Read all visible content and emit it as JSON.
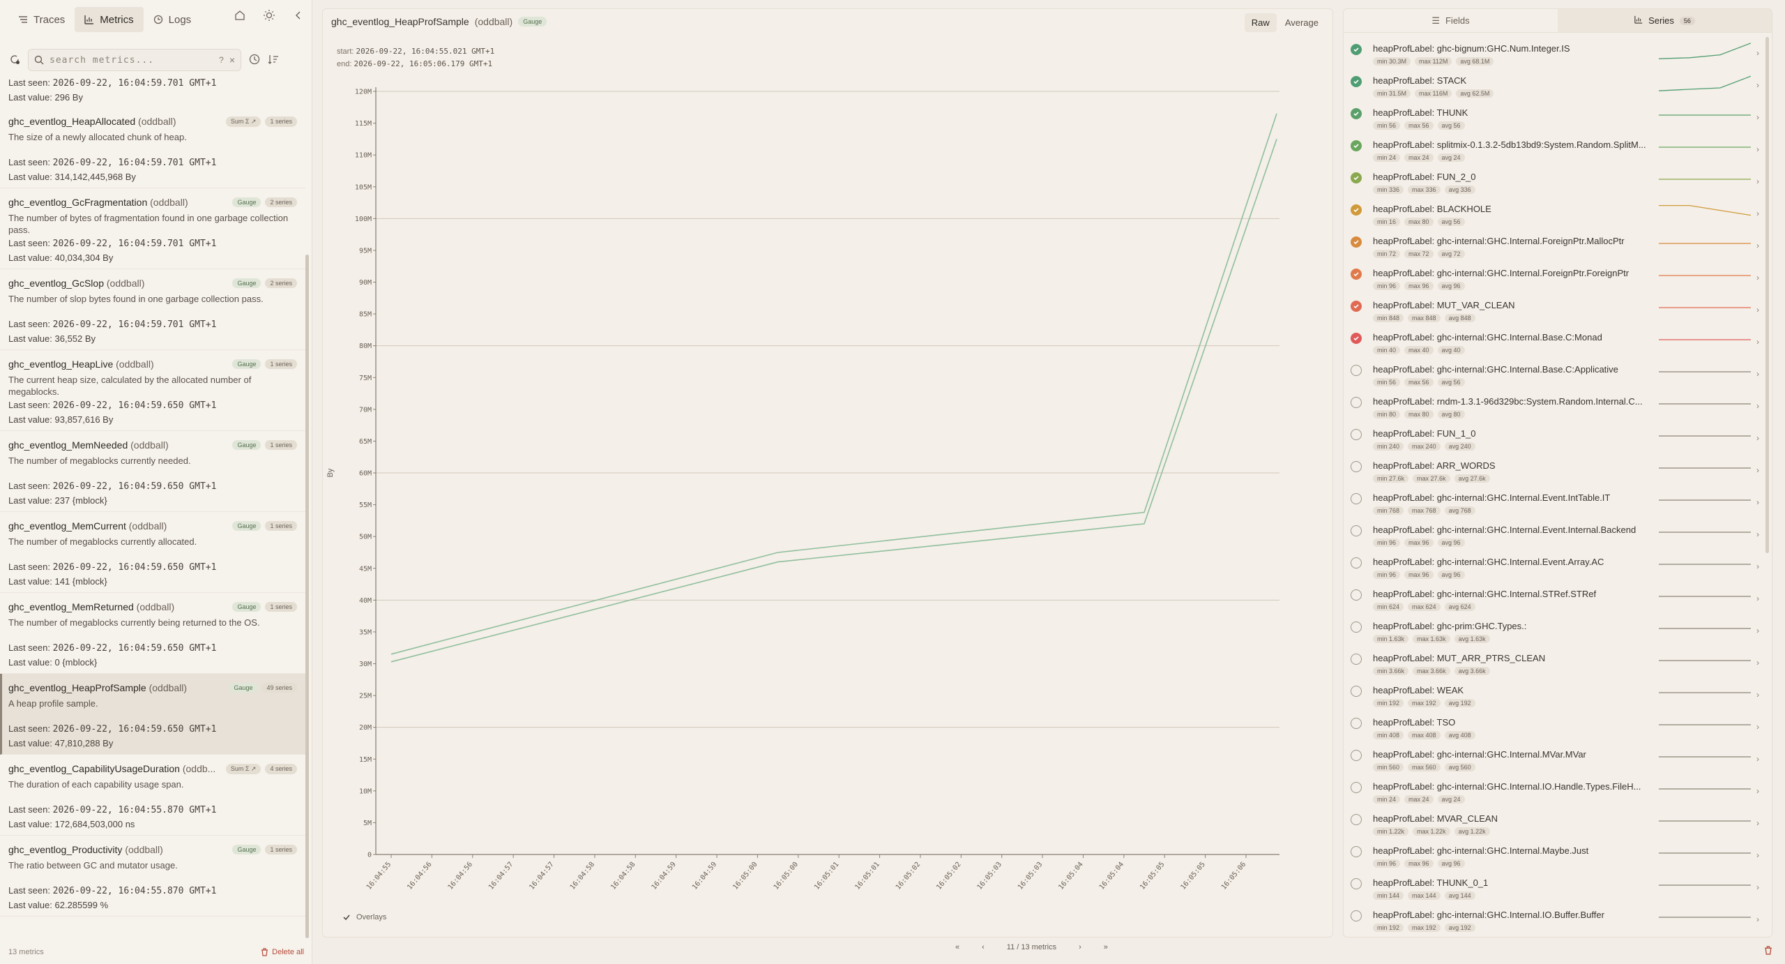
{
  "nav": {
    "tabs": [
      {
        "label": "Traces",
        "icon": "traces-icon"
      },
      {
        "label": "Metrics",
        "icon": "metrics-icon"
      },
      {
        "label": "Logs",
        "icon": "logs-icon"
      }
    ]
  },
  "search": {
    "placeholder": "search metrics...",
    "help": "?"
  },
  "partial_item": {
    "last_seen_label": "Last seen:",
    "last_seen": "2026-09-22, 16:04:59.701 GMT+1",
    "last_value_label": "Last value:",
    "last_value": "296 By"
  },
  "metrics": [
    {
      "name": "ghc_eventlog_HeapAllocated",
      "source": "(oddball)",
      "type": "Sum Σ ↗",
      "type_style": "gray",
      "series": "1 series",
      "desc": "The size of a newly allocated chunk of heap.",
      "last_seen": "2026-09-22, 16:04:59.701 GMT+1",
      "last_value": "314,142,445,968 By"
    },
    {
      "name": "ghc_eventlog_GcFragmentation",
      "source": "(oddball)",
      "type": "Gauge",
      "type_style": "green",
      "series": "2 series",
      "desc": "The number of bytes of fragmentation found in one garbage collection pass.",
      "last_seen": "2026-09-22, 16:04:59.701 GMT+1",
      "last_value": "40,034,304 By"
    },
    {
      "name": "ghc_eventlog_GcSlop",
      "source": "(oddball)",
      "type": "Gauge",
      "type_style": "green",
      "series": "2 series",
      "desc": "The number of slop bytes found in one garbage collection pass.",
      "last_seen": "2026-09-22, 16:04:59.701 GMT+1",
      "last_value": "36,552 By"
    },
    {
      "name": "ghc_eventlog_HeapLive",
      "source": "(oddball)",
      "type": "Gauge",
      "type_style": "green",
      "series": "1 series",
      "desc": "The current heap size, calculated by the allocated number of megablocks.",
      "last_seen": "2026-09-22, 16:04:59.650 GMT+1",
      "last_value": "93,857,616 By"
    },
    {
      "name": "ghc_eventlog_MemNeeded",
      "source": "(oddball)",
      "type": "Gauge",
      "type_style": "green",
      "series": "1 series",
      "desc": "The number of megablocks currently needed.",
      "last_seen": "2026-09-22, 16:04:59.650 GMT+1",
      "last_value": "237 {mblock}"
    },
    {
      "name": "ghc_eventlog_MemCurrent",
      "source": "(oddball)",
      "type": "Gauge",
      "type_style": "green",
      "series": "1 series",
      "desc": "The number of megablocks currently allocated.",
      "last_seen": "2026-09-22, 16:04:59.650 GMT+1",
      "last_value": "141 {mblock}"
    },
    {
      "name": "ghc_eventlog_MemReturned",
      "source": "(oddball)",
      "type": "Gauge",
      "type_style": "green",
      "series": "1 series",
      "desc": "The number of megablocks currently being returned to the OS.",
      "last_seen": "2026-09-22, 16:04:59.650 GMT+1",
      "last_value": "0 {mblock}"
    },
    {
      "name": "ghc_eventlog_HeapProfSample",
      "source": "(oddball)",
      "type": "Gauge",
      "type_style": "green",
      "series": "49 series",
      "desc": "A heap profile sample.",
      "last_seen": "2026-09-22, 16:04:59.650 GMT+1",
      "last_value": "47,810,288 By",
      "selected": true
    },
    {
      "name": "ghc_eventlog_CapabilityUsageDuration",
      "source": "(oddb...",
      "type": "Sum Σ ↗",
      "type_style": "gray",
      "series": "4 series",
      "desc": "The duration of each capability usage span.",
      "last_seen": "2026-09-22, 16:04:55.870 GMT+1",
      "last_value": "172,684,503,000 ns"
    },
    {
      "name": "ghc_eventlog_Productivity",
      "source": "(oddball)",
      "type": "Gauge",
      "type_style": "green",
      "series": "1 series",
      "desc": "The ratio between GC and mutator usage.",
      "last_seen": "2026-09-22, 16:04:55.870 GMT+1",
      "last_value": "62.285599 %"
    }
  ],
  "labels": {
    "last_seen": "Last seen:",
    "last_value": "Last value:"
  },
  "left_footer": {
    "count": "13 metrics",
    "delete_all": "Delete all"
  },
  "center": {
    "title": "ghc_eventlog_HeapProfSample",
    "source": "(oddball)",
    "type": "Gauge",
    "modes": [
      "Raw",
      "Average"
    ],
    "start_label": "start:",
    "start": "2026-09-22, 16:04:55.021 GMT+1",
    "end_label": "end:",
    "end": "2026-09-22, 16:05:06.179 GMT+1",
    "overlays": "Overlays"
  },
  "chart_data": {
    "type": "line",
    "ylabel": "By",
    "y_ticks": [
      "0",
      "5M",
      "10M",
      "15M",
      "20M",
      "25M",
      "30M",
      "35M",
      "40M",
      "45M",
      "50M",
      "55M",
      "60M",
      "65M",
      "70M",
      "75M",
      "80M",
      "85M",
      "90M",
      "95M",
      "100M",
      "105M",
      "110M",
      "115M",
      "120M"
    ],
    "ylim": [
      0,
      120
    ],
    "y_unit": "M",
    "x_ticks": [
      "16:04:55",
      "16:04:56",
      "16:04:56",
      "16:04:57",
      "16:04:57",
      "16:04:58",
      "16:04:58",
      "16:04:59",
      "16:04:59",
      "16:05:00",
      "16:05:00",
      "16:05:01",
      "16:05:01",
      "16:05:02",
      "16:05:02",
      "16:05:03",
      "16:05:03",
      "16:05:04",
      "16:05:04",
      "16:05:05",
      "16:05:05",
      "16:05:06"
    ],
    "xlim": [
      0,
      21
    ],
    "series": [
      {
        "x": [
          0,
          9.5,
          18.5,
          22.3
        ],
        "values": [
          31.5,
          47.5,
          53.8,
          116.5
        ]
      },
      {
        "x": [
          0,
          9.5,
          18.5,
          22.3
        ],
        "values": [
          30.3,
          46.0,
          52.0,
          112.5
        ]
      }
    ],
    "grid": true,
    "major_grid_every": 20
  },
  "pager": {
    "text": "11 / 13 metrics"
  },
  "right": {
    "tabs": [
      {
        "label": "Fields"
      },
      {
        "label": "Series",
        "count": "56"
      }
    ],
    "series": [
      {
        "label": "heapProfLabel: ghc-bignum:GHC.Num.Integer.IS",
        "min": "min 30.3M",
        "max": "max 112M",
        "avg": "avg 68.1M",
        "on": true,
        "color": "#4f9d72",
        "spark": [
          0.9,
          0.85,
          0.7,
          0.1
        ]
      },
      {
        "label": "heapProfLabel: STACK",
        "min": "min 31.5M",
        "max": "max 116M",
        "avg": "avg 62.5M",
        "on": true,
        "color": "#4f9d72",
        "spark": [
          0.9,
          0.82,
          0.75,
          0.15
        ]
      },
      {
        "label": "heapProfLabel: THUNK",
        "min": "min 56",
        "max": "max 56",
        "avg": "avg 56",
        "on": true,
        "color": "#5aa06a",
        "spark": [
          0.5,
          0.5,
          0.5,
          0.5
        ]
      },
      {
        "label": "heapProfLabel: splitmix-0.1.3.2-5db13bd9:System.Random.SplitM...",
        "min": "min 24",
        "max": "max 24",
        "avg": "avg 24",
        "on": true,
        "color": "#6aa65e",
        "spark": [
          0.5,
          0.5,
          0.5,
          0.5
        ]
      },
      {
        "label": "heapProfLabel: FUN_2_0",
        "min": "min 336",
        "max": "max 336",
        "avg": "avg 336",
        "on": true,
        "color": "#8aa84e",
        "spark": [
          0.5,
          0.5,
          0.5,
          0.5
        ]
      },
      {
        "label": "heapProfLabel: BLACKHOLE",
        "min": "min 16",
        "max": "max 80",
        "avg": "avg 56",
        "on": true,
        "color": "#d09a3a",
        "spark": [
          0.2,
          0.2,
          0.45,
          0.7
        ]
      },
      {
        "label": "heapProfLabel: ghc-internal:GHC.Internal.ForeignPtr.MallocPtr",
        "min": "min 72",
        "max": "max 72",
        "avg": "avg 72",
        "on": true,
        "color": "#d88a3e",
        "spark": [
          0.5,
          0.5,
          0.5,
          0.5
        ]
      },
      {
        "label": "heapProfLabel: ghc-internal:GHC.Internal.ForeignPtr.ForeignPtr",
        "min": "min 96",
        "max": "max 96",
        "avg": "avg 96",
        "on": true,
        "color": "#e07a4a",
        "spark": [
          0.5,
          0.5,
          0.5,
          0.5
        ]
      },
      {
        "label": "heapProfLabel: MUT_VAR_CLEAN",
        "min": "min 848",
        "max": "max 848",
        "avg": "avg 848",
        "on": true,
        "color": "#e06a52",
        "spark": [
          0.5,
          0.5,
          0.5,
          0.5
        ]
      },
      {
        "label": "heapProfLabel: ghc-internal:GHC.Internal.Base.C:Monad",
        "min": "min 40",
        "max": "max 40",
        "avg": "avg 40",
        "on": true,
        "color": "#e05a5a",
        "spark": [
          0.5,
          0.5,
          0.5,
          0.5
        ]
      },
      {
        "label": "heapProfLabel: ghc-internal:GHC.Internal.Base.C:Applicative",
        "min": "min 56",
        "max": "max 56",
        "avg": "avg 56",
        "on": false,
        "color": "#8c8379",
        "spark": [
          0.5,
          0.5,
          0.5,
          0.5
        ]
      },
      {
        "label": "heapProfLabel: rndm-1.3.1-96d329bc:System.Random.Internal.C...",
        "min": "min 80",
        "max": "max 80",
        "avg": "avg 80",
        "on": false,
        "color": "#8c8379",
        "spark": [
          0.5,
          0.5,
          0.5,
          0.5
        ]
      },
      {
        "label": "heapProfLabel: FUN_1_0",
        "min": "min 240",
        "max": "max 240",
        "avg": "avg 240",
        "on": false,
        "color": "#8c8379",
        "spark": [
          0.5,
          0.5,
          0.5,
          0.5
        ]
      },
      {
        "label": "heapProfLabel: ARR_WORDS",
        "min": "min 27.6k",
        "max": "max 27.6k",
        "avg": "avg 27.6k",
        "on": false,
        "color": "#8c8379",
        "spark": [
          0.5,
          0.5,
          0.5,
          0.5
        ]
      },
      {
        "label": "heapProfLabel: ghc-internal:GHC.Internal.Event.IntTable.IT",
        "min": "min 768",
        "max": "max 768",
        "avg": "avg 768",
        "on": false,
        "color": "#8c8379",
        "spark": [
          0.5,
          0.5,
          0.5,
          0.5
        ]
      },
      {
        "label": "heapProfLabel: ghc-internal:GHC.Internal.Event.Internal.Backend",
        "min": "min 96",
        "max": "max 96",
        "avg": "avg 96",
        "on": false,
        "color": "#8c8379",
        "spark": [
          0.5,
          0.5,
          0.5,
          0.5
        ]
      },
      {
        "label": "heapProfLabel: ghc-internal:GHC.Internal.Event.Array.AC",
        "min": "min 96",
        "max": "max 96",
        "avg": "avg 96",
        "on": false,
        "color": "#8c8379",
        "spark": [
          0.5,
          0.5,
          0.5,
          0.5
        ]
      },
      {
        "label": "heapProfLabel: ghc-internal:GHC.Internal.STRef.STRef",
        "min": "min 624",
        "max": "max 624",
        "avg": "avg 624",
        "on": false,
        "color": "#8c8379",
        "spark": [
          0.5,
          0.5,
          0.5,
          0.5
        ]
      },
      {
        "label": "heapProfLabel: ghc-prim:GHC.Types.:",
        "min": "min 1.63k",
        "max": "max 1.63k",
        "avg": "avg 1.63k",
        "on": false,
        "color": "#8c8379",
        "spark": [
          0.5,
          0.5,
          0.5,
          0.5
        ]
      },
      {
        "label": "heapProfLabel: MUT_ARR_PTRS_CLEAN",
        "min": "min 3.66k",
        "max": "max 3.66k",
        "avg": "avg 3.66k",
        "on": false,
        "color": "#8c8379",
        "spark": [
          0.5,
          0.5,
          0.5,
          0.5
        ]
      },
      {
        "label": "heapProfLabel: WEAK",
        "min": "min 192",
        "max": "max 192",
        "avg": "avg 192",
        "on": false,
        "color": "#8c8379",
        "spark": [
          0.5,
          0.5,
          0.5,
          0.5
        ]
      },
      {
        "label": "heapProfLabel: TSO",
        "min": "min 408",
        "max": "max 408",
        "avg": "avg 408",
        "on": false,
        "color": "#8c8379",
        "spark": [
          0.5,
          0.5,
          0.5,
          0.5
        ]
      },
      {
        "label": "heapProfLabel: ghc-internal:GHC.Internal.MVar.MVar",
        "min": "min 560",
        "max": "max 560",
        "avg": "avg 560",
        "on": false,
        "color": "#8c8379",
        "spark": [
          0.5,
          0.5,
          0.5,
          0.5
        ]
      },
      {
        "label": "heapProfLabel: ghc-internal:GHC.Internal.IO.Handle.Types.FileH...",
        "min": "min 24",
        "max": "max 24",
        "avg": "avg 24",
        "on": false,
        "color": "#8c8379",
        "spark": [
          0.5,
          0.5,
          0.5,
          0.5
        ]
      },
      {
        "label": "heapProfLabel: MVAR_CLEAN",
        "min": "min 1.22k",
        "max": "max 1.22k",
        "avg": "avg 1.22k",
        "on": false,
        "color": "#8c8379",
        "spark": [
          0.5,
          0.5,
          0.5,
          0.5
        ]
      },
      {
        "label": "heapProfLabel: ghc-internal:GHC.Internal.Maybe.Just",
        "min": "min 96",
        "max": "max 96",
        "avg": "avg 96",
        "on": false,
        "color": "#8c8379",
        "spark": [
          0.5,
          0.5,
          0.5,
          0.5
        ]
      },
      {
        "label": "heapProfLabel: THUNK_0_1",
        "min": "min 144",
        "max": "max 144",
        "avg": "avg 144",
        "on": false,
        "color": "#8c8379",
        "spark": [
          0.5,
          0.5,
          0.5,
          0.5
        ]
      },
      {
        "label": "heapProfLabel: ghc-internal:GHC.Internal.IO.Buffer.Buffer",
        "min": "min 192",
        "max": "max 192",
        "avg": "avg 192",
        "on": false,
        "color": "#8c8379",
        "spark": [
          0.5,
          0.5,
          0.5,
          0.5
        ]
      }
    ]
  }
}
